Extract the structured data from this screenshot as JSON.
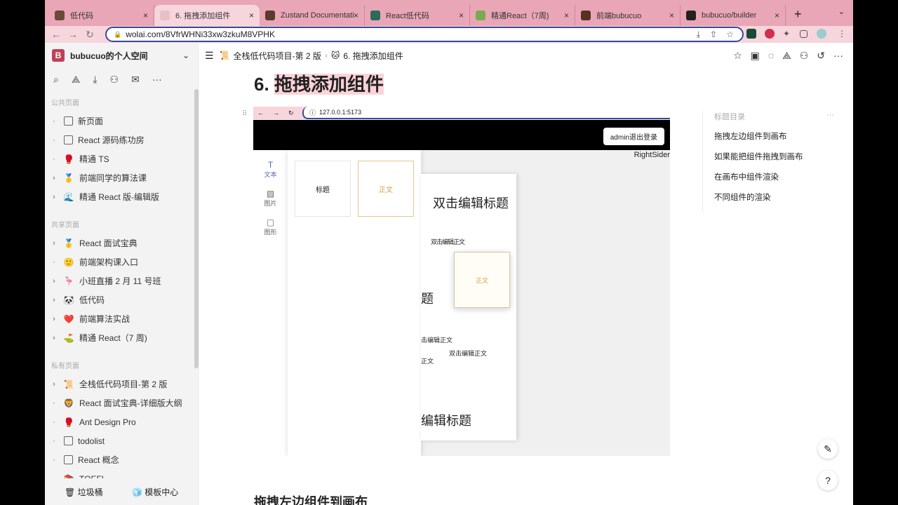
{
  "browser": {
    "tabs": [
      {
        "title": "低代码",
        "color": "#6b4a3a"
      },
      {
        "title": "6. 拖拽添加组件",
        "color": "#e8c0c8",
        "active": true
      },
      {
        "title": "Zustand Documentati",
        "color": "#5a3a2a"
      },
      {
        "title": "React低代码",
        "color": "#2b6b5b"
      },
      {
        "title": "精通React（7周)",
        "color": "#7aaa50"
      },
      {
        "title": "前端bubucuo",
        "color": "#553322"
      },
      {
        "title": "bubucuo/builder",
        "color": "#222222"
      }
    ],
    "close": "×",
    "new_tab": "+",
    "menu": "⌄",
    "url": "wolai.com/8VfrWHNi33xw3zkuM8VPHK"
  },
  "sidebar": {
    "workspace": "bubucuo的个人空间",
    "logo": "B",
    "sections": [
      {
        "label": "公共页面",
        "items": [
          {
            "label": "新页面",
            "icon": "page",
            "arrow": "·"
          },
          {
            "label": "React 源码练功房",
            "icon": "page",
            "arrow": "·"
          },
          {
            "label": "精通 TS",
            "icon": "🥊",
            "arrow": "·"
          },
          {
            "label": "前端同学的算法课",
            "icon": "🥇",
            "arrow": "›"
          },
          {
            "label": "精通 React 版-编辑版",
            "icon": "🌊",
            "arrow": "›"
          }
        ]
      },
      {
        "label": "共享页面",
        "items": [
          {
            "label": "React 面试宝典",
            "icon": "🥇",
            "arrow": "›"
          },
          {
            "label": "前端架构课入口",
            "icon": "🙂",
            "arrow": "·"
          },
          {
            "label": "小班直播 2 月 11 号班",
            "icon": "🦩",
            "arrow": "›"
          },
          {
            "label": "低代码",
            "icon": "🐼",
            "arrow": "›"
          },
          {
            "label": "前端算法实战",
            "icon": "❤️",
            "arrow": "›"
          },
          {
            "label": "精通 React（7 周)",
            "icon": "⛳",
            "arrow": "›"
          }
        ]
      },
      {
        "label": "私有页面",
        "items": [
          {
            "label": "全栈低代码项目-第 2 版",
            "icon": "📜",
            "arrow": "›"
          },
          {
            "label": "React 面试宝典-详细版大纲",
            "icon": "🦁",
            "arrow": "·"
          },
          {
            "label": "Ant Design Pro",
            "icon": "🥊",
            "arrow": "·"
          },
          {
            "label": "todolist",
            "icon": "page",
            "arrow": "·"
          },
          {
            "label": "React 概念",
            "icon": "page",
            "arrow": "·"
          },
          {
            "label": "TOEFL",
            "icon": "📚",
            "arrow": "·"
          }
        ]
      }
    ],
    "trash": "垃圾桶",
    "templates": "模板中心"
  },
  "breadcrumb": [
    "全栈低代码项目-第 2 版",
    "6. 拖拽添加组件"
  ],
  "page": {
    "number": "6.",
    "title": "拖拽添加组件",
    "section_heading": "拖拽左边组件到画布"
  },
  "embedded": {
    "url": "127.0.0.1:5173",
    "logout": "admin退出登录",
    "right_sider": "RightSider",
    "tools": [
      {
        "label": "文本",
        "glyph": "T"
      },
      {
        "label": "图片",
        "glyph": "▨"
      },
      {
        "label": "图形",
        "glyph": "▢"
      }
    ],
    "cards": [
      "标题",
      "正文"
    ],
    "canvas": {
      "title1": "双击编辑标题",
      "overlap": "双击编辑正文",
      "title_partial": "题",
      "text_partial1": "击编辑正文",
      "text2": "双击编辑正文",
      "text_partial3": "正文",
      "title_partial2": "编辑标题",
      "dragging": "正文"
    }
  },
  "toc": {
    "label": "标题目录",
    "more": "···",
    "entries": [
      "拖拽左边组件到画布",
      "如果能把组件拖拽到画布",
      "在画布中组件渲染",
      "不同组件的渲染"
    ]
  }
}
